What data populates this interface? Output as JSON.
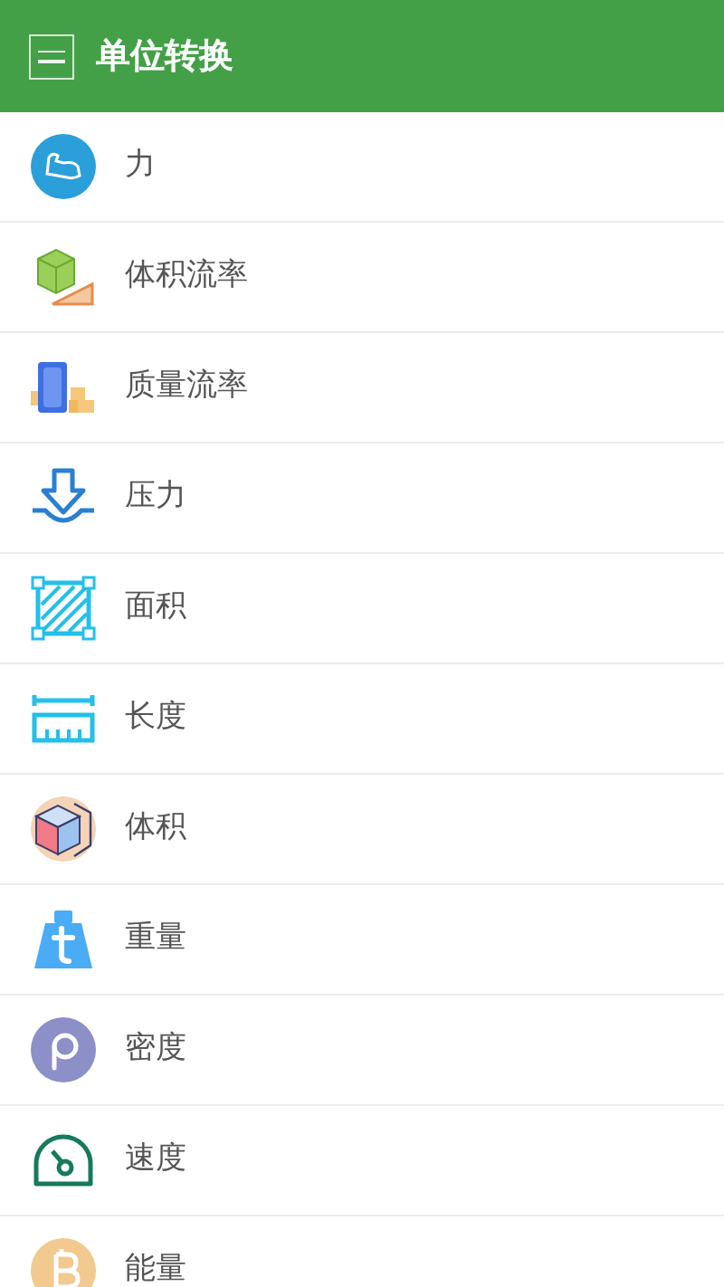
{
  "header": {
    "title": "单位转换"
  },
  "items": [
    {
      "kind": "force",
      "label": "力"
    },
    {
      "kind": "flow",
      "label": "体积流率"
    },
    {
      "kind": "massflow",
      "label": "质量流率"
    },
    {
      "kind": "pressure",
      "label": "压力"
    },
    {
      "kind": "area",
      "label": "面积"
    },
    {
      "kind": "length",
      "label": "长度"
    },
    {
      "kind": "volume",
      "label": "体积"
    },
    {
      "kind": "weight",
      "label": "重量"
    },
    {
      "kind": "density",
      "label": "密度"
    },
    {
      "kind": "speed",
      "label": "速度"
    },
    {
      "kind": "energy",
      "label": "能量"
    }
  ]
}
